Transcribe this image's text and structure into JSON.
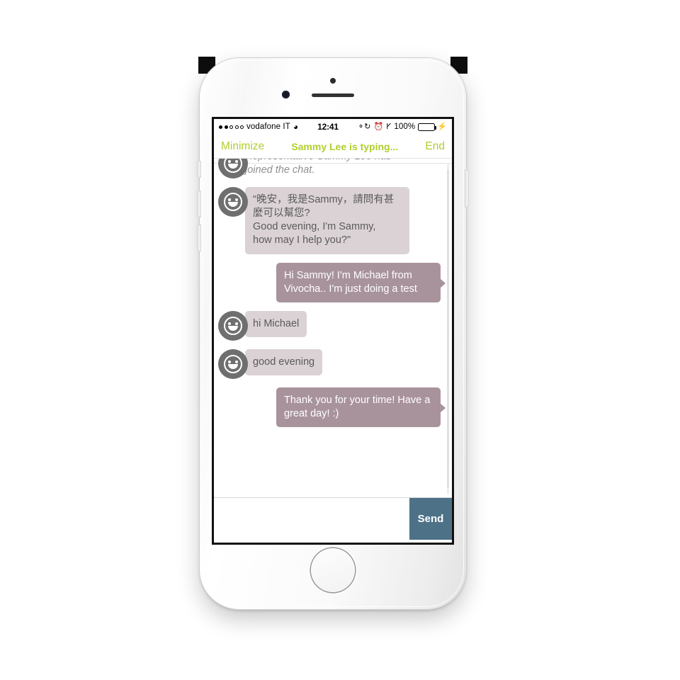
{
  "status_bar": {
    "signal_filled_dots": 2,
    "signal_total_dots": 5,
    "carrier": "vodafone IT",
    "wifi_icon": "wifi-icon",
    "time": "12:41",
    "rotation_lock_icon": "rotation-lock-icon",
    "alarm_icon": "alarm-clock-icon",
    "bluetooth_icon": "bluetooth-icon",
    "battery_percent": "100%",
    "battery_color": "#4cd964",
    "charging_icon": "charging-bolt-icon"
  },
  "toolbar": {
    "minimize_label": "Minimize",
    "typing_status": "Sammy Lee is typing...",
    "end_label": "End",
    "accent_color": "#b0cf2e"
  },
  "chat": {
    "agent_bubble_color": "#dbd2d6",
    "user_bubble_color": "#a8939c",
    "avatar_color": "#6f6f6f",
    "messages": [
      {
        "type": "system",
        "text": "Representative Sammy Lee has joined the chat.",
        "clipped": true
      },
      {
        "type": "agent",
        "text": "\"晚安，我是Sammy，請問有甚麼可以幫您?\nGood evening, I'm Sammy,\nhow may I help you?\""
      },
      {
        "type": "user",
        "text": "Hi Sammy! I'm Michael from Vivocha.. I'm just doing a test"
      },
      {
        "type": "agent",
        "text": "hi Michael"
      },
      {
        "type": "agent",
        "text": "good evening"
      },
      {
        "type": "user",
        "text": "Thank you for your time! Have a great day! :)"
      }
    ]
  },
  "composer": {
    "input_value": "",
    "input_placeholder": "",
    "send_label": "Send",
    "send_color": "#4d7287"
  }
}
